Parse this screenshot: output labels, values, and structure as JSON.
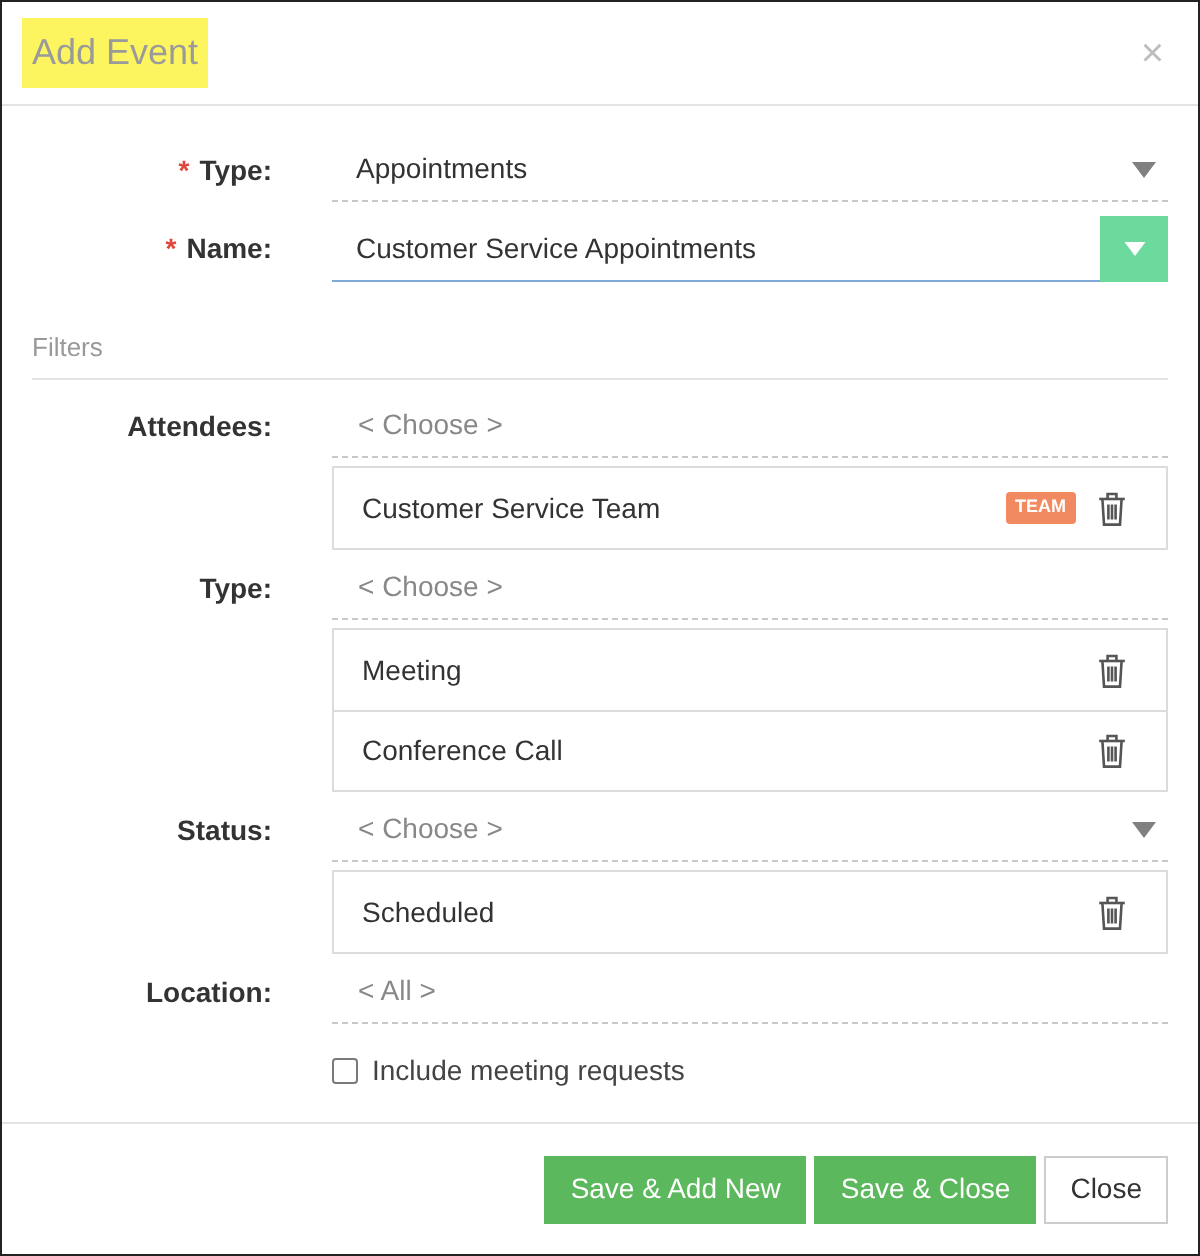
{
  "window": {
    "title": "Add Event",
    "title_highlighted": true,
    "close_button": "×"
  },
  "fields": [
    {
      "kind": "select",
      "required_mark": "*",
      "label": "Type:",
      "value": "Appointments",
      "focused": false
    },
    {
      "kind": "combo",
      "required_mark": "*",
      "label": "Name:",
      "value": "Customer Service Appointments",
      "focused": true
    }
  ],
  "filters": {
    "heading": "Filters",
    "groups": [
      {
        "label": "Attendees:",
        "placeholder": "< Choose >",
        "dropdown": false,
        "items": [
          {
            "text": "Customer Service Team",
            "badge": "TEAM"
          }
        ]
      },
      {
        "label": "Type:",
        "placeholder": "< Choose >",
        "dropdown": false,
        "items": [
          {
            "text": "Meeting"
          },
          {
            "text": "Conference Call"
          }
        ]
      },
      {
        "label": "Status:",
        "placeholder": "< Choose >",
        "dropdown": true,
        "items": [
          {
            "text": "Scheduled"
          }
        ]
      },
      {
        "label": "Location:",
        "placeholder": "< All >",
        "dropdown": false
      }
    ]
  },
  "checkbox": {
    "label": "Include meeting requests",
    "checked": false
  },
  "buttons": [
    {
      "label": "Save & Add New",
      "kind": "primary"
    },
    {
      "label": "Save & Close",
      "kind": "primary"
    },
    {
      "label": "Close",
      "kind": "default"
    }
  ]
}
